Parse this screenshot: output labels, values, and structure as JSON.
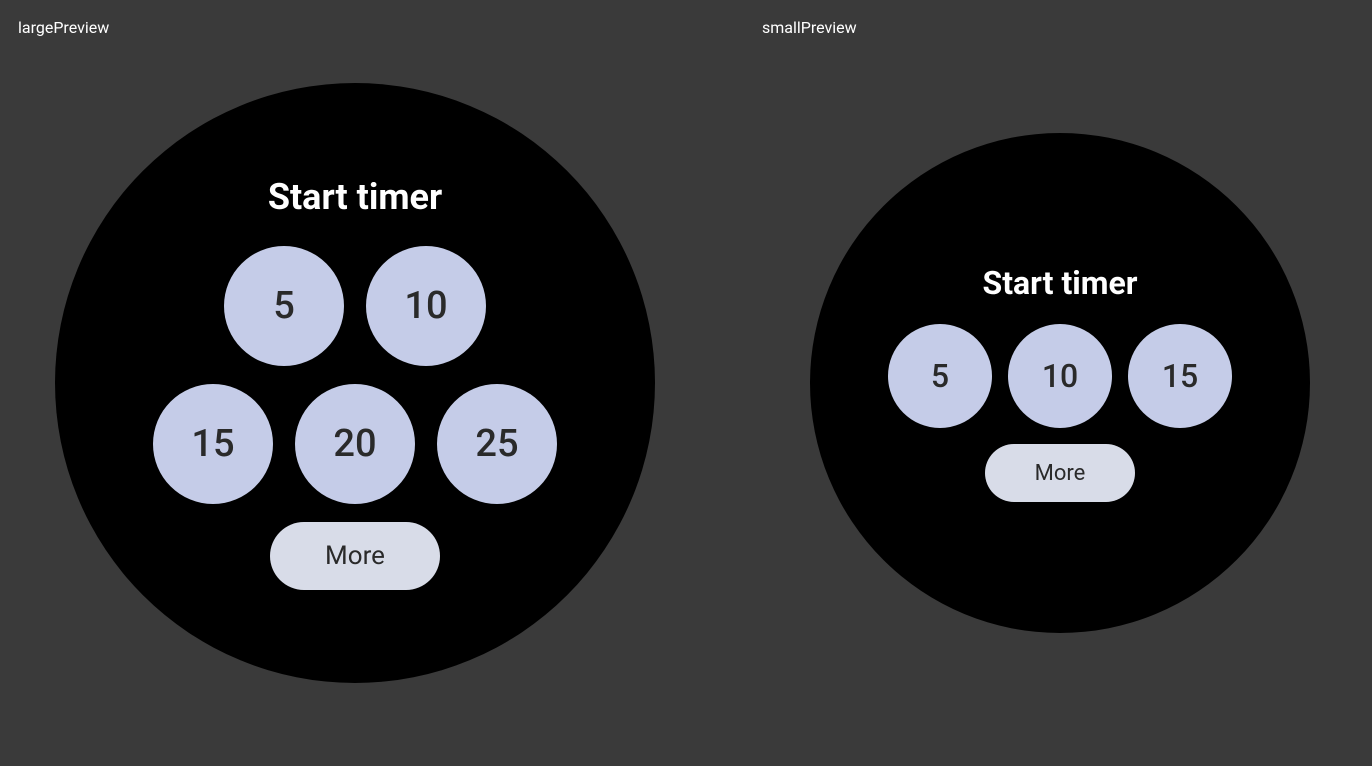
{
  "labels": {
    "large_preview": "largePreview",
    "small_preview": "smallPreview"
  },
  "large_watch": {
    "title": "Start timer",
    "row1": [
      "5",
      "10"
    ],
    "row2": [
      "15",
      "20",
      "25"
    ],
    "more_label": "More"
  },
  "small_watch": {
    "title": "Start timer",
    "row1": [
      "5",
      "10",
      "15"
    ],
    "more_label": "More"
  }
}
